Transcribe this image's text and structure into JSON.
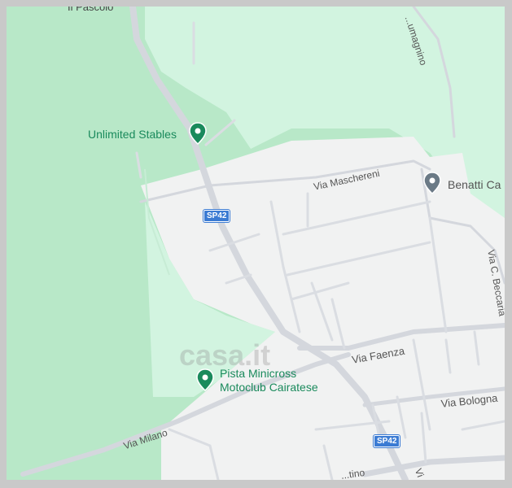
{
  "map": {
    "pois": [
      {
        "name": "Unlimited Stables",
        "kind": "green"
      },
      {
        "name": "Benatti Ca",
        "kind": "grey"
      },
      {
        "name_line1": "Pista Minicross",
        "name_line2": "Motoclub Cairatese",
        "kind": "green"
      }
    ],
    "top_left_place": "Il Pascolo",
    "streets": {
      "top_right": "...umagnino",
      "maschereni": "Via Maschereni",
      "beccaria": "Via C. Beccaria",
      "faenza": "Via Faenza",
      "bologna": "Via Bologna",
      "milano": "Via Milano",
      "bottom": "...tino",
      "bottom_right": "Vi"
    },
    "shields": [
      "SP42",
      "SP42"
    ],
    "watermark": "casa.it",
    "colors": {
      "park": "#b8e8c8",
      "light_park": "#d2f4e0",
      "urban": "#f1f2f2",
      "road": "#d4d7dd",
      "poi_green": "#1a8a5c",
      "poi_grey": "#6b7a86",
      "shield": "#3b7bd3"
    }
  }
}
